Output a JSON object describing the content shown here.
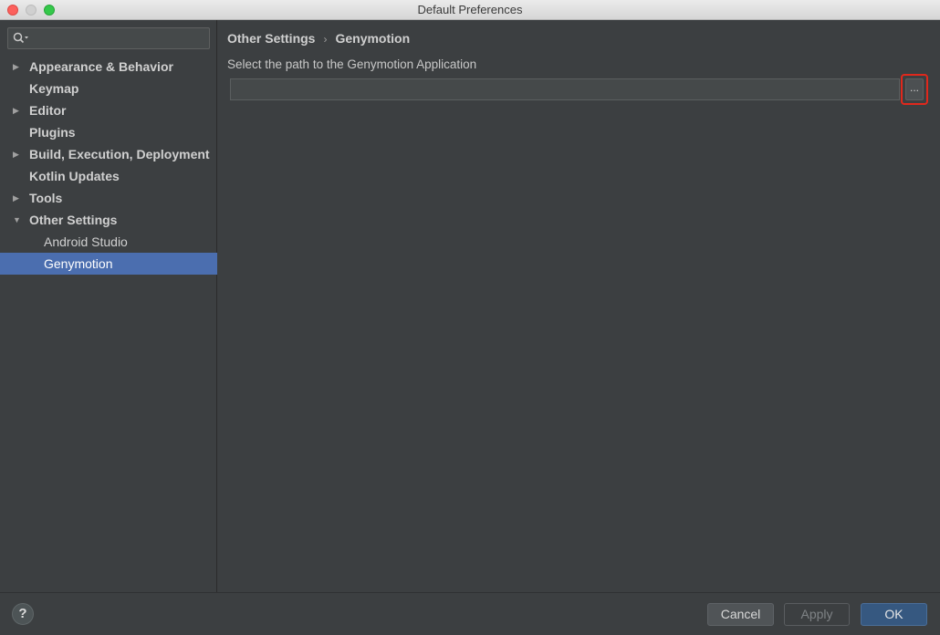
{
  "window": {
    "title": "Default Preferences"
  },
  "sidebar": {
    "search": {
      "value": ""
    },
    "items": [
      {
        "label": "Appearance & Behavior",
        "arrow": "▶"
      },
      {
        "label": "Keymap",
        "arrow": ""
      },
      {
        "label": "Editor",
        "arrow": "▶"
      },
      {
        "label": "Plugins",
        "arrow": ""
      },
      {
        "label": "Build, Execution, Deployment",
        "arrow": "▶"
      },
      {
        "label": "Kotlin Updates",
        "arrow": ""
      },
      {
        "label": "Tools",
        "arrow": "▶"
      },
      {
        "label": "Other Settings",
        "arrow": "▼"
      },
      {
        "label": "Android Studio",
        "arrow": ""
      },
      {
        "label": "Genymotion",
        "arrow": ""
      }
    ]
  },
  "main": {
    "breadcrumb": {
      "parent": "Other Settings",
      "separator": "›",
      "current": "Genymotion"
    },
    "hint": "Select the path to the Genymotion Application",
    "path_value": "",
    "browse_label": "..."
  },
  "footer": {
    "help_label": "?",
    "cancel_label": "Cancel",
    "apply_label": "Apply",
    "ok_label": "OK"
  },
  "colors": {
    "selection": "#4b6eaf",
    "highlight_border": "#e0281c",
    "ok_button": "#365880"
  }
}
